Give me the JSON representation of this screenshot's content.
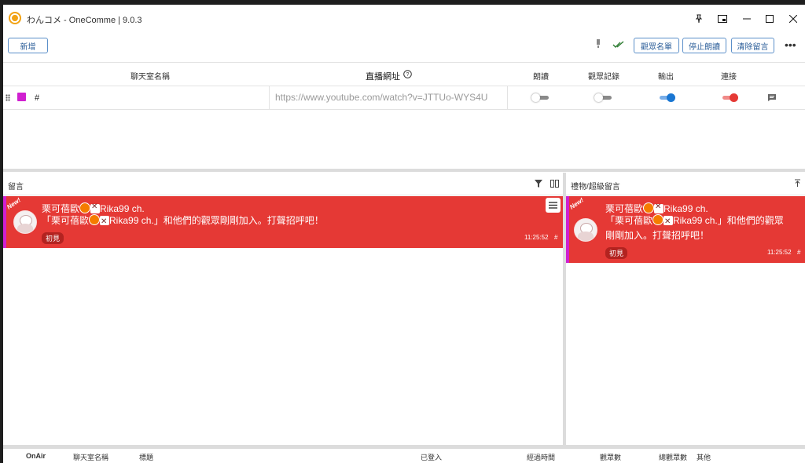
{
  "app": {
    "title": "わんコメ - OneComme | 9.0.3"
  },
  "titlebar_icons": [
    "pin-icon",
    "picture-in-picture-icon",
    "minimize-icon",
    "maximize-icon",
    "close-icon"
  ],
  "toolbar": {
    "add_label": "新增",
    "viewer_list_label": "觀眾名單",
    "stop_reading_label": "停止朗讀",
    "clear_comments_label": "清除留言"
  },
  "table": {
    "headers": {
      "room_name": "聊天室名稱",
      "url": "直播網址",
      "read": "朗讀",
      "viewer_log": "觀眾記錄",
      "output": "輸出",
      "connect": "連接"
    },
    "rows": [
      {
        "color": "#d020d0",
        "name": "#",
        "url": "https://www.youtube.com/watch?v=JTTUo-WYS4U",
        "read": false,
        "viewer_log": false,
        "output": true,
        "connect": true
      }
    ]
  },
  "comments_panel": {
    "title": "留言",
    "messages": [
      {
        "ribbon": "New!",
        "name_prefix": "栗可蓓歐",
        "name_suffix": "Rika99 ch.",
        "text_line1_prefix": "「栗可蓓歐",
        "text_line1_suffix": "Rika99 ch.」和他們的觀眾剛剛加入。打聲招呼吧！",
        "badge": "初見",
        "time": "11:25:52",
        "hash": "#"
      }
    ]
  },
  "gifts_panel": {
    "title": "禮物/超級留言",
    "messages": [
      {
        "ribbon": "New!",
        "name_prefix": "栗可蓓歐",
        "name_suffix": "Rika99 ch.",
        "text_line1_prefix": "「栗可蓓歐",
        "text_line1_suffix": "Rika99 ch.」和他們的觀眾",
        "text_line2": "剛剛加入。打聲招呼吧！",
        "badge": "初見",
        "time": "11:25:52",
        "hash": "#"
      }
    ]
  },
  "footer": {
    "columns": [
      "OnAir",
      "聊天室名稱",
      "標題",
      "已登入",
      "經過時間",
      "觀眾數",
      "總觀眾數",
      "其他"
    ]
  },
  "colors": {
    "accent_blue": "#2d5f9a",
    "message_red": "#e53935",
    "toggle_on_blue": "#1976d2",
    "toggle_on_red": "#e53935",
    "room_color": "#d020d0"
  }
}
